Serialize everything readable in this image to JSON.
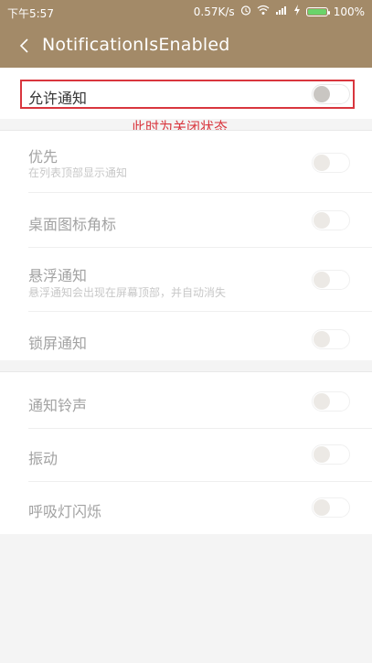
{
  "status_bar": {
    "time": "下午5:57",
    "net_speed": "0.57K/s",
    "battery_text": "100%",
    "battery_color": "#6ad36a",
    "icons": [
      "alarm-icon",
      "wifi-icon",
      "signal-icon",
      "charging-icon",
      "battery-icon"
    ]
  },
  "app_bar": {
    "title": "NotificationIsEnabled",
    "background": "#a38a68"
  },
  "main_toggle": {
    "label": "允许通知",
    "enabled": false
  },
  "annotation": {
    "text": "此时为关闭状态",
    "color": "#d9363e"
  },
  "sections": [
    {
      "items": [
        {
          "label": "优先",
          "subtitle": "在列表顶部显示通知",
          "enabled": false
        },
        {
          "label": "桌面图标角标",
          "subtitle": "",
          "enabled": false
        },
        {
          "label": "悬浮通知",
          "subtitle": "悬浮通知会出现在屏幕顶部，并自动消失",
          "enabled": false
        },
        {
          "label": "锁屏通知",
          "subtitle": "",
          "enabled": false
        }
      ]
    },
    {
      "items": [
        {
          "label": "通知铃声",
          "subtitle": "",
          "enabled": false
        },
        {
          "label": "振动",
          "subtitle": "",
          "enabled": false
        },
        {
          "label": "呼吸灯闪烁",
          "subtitle": "",
          "enabled": false
        }
      ]
    }
  ]
}
